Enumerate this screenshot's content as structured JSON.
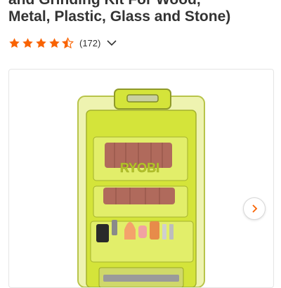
{
  "product": {
    "title_lines": [
      "and Grinding Kit For Wood,",
      "Metal, Plastic, Glass and Stone)"
    ],
    "rating_stars": 4.5,
    "review_count": "(172)"
  },
  "image_box": {
    "brand_text": "RYOBI"
  },
  "colors": {
    "star": "#f96302",
    "case_lime": "#d4e43a",
    "sanding_band": "#b06a5c"
  },
  "icons": {
    "rating_toggle": "chevron-down-icon",
    "carousel_next": "chevron-right-icon"
  }
}
